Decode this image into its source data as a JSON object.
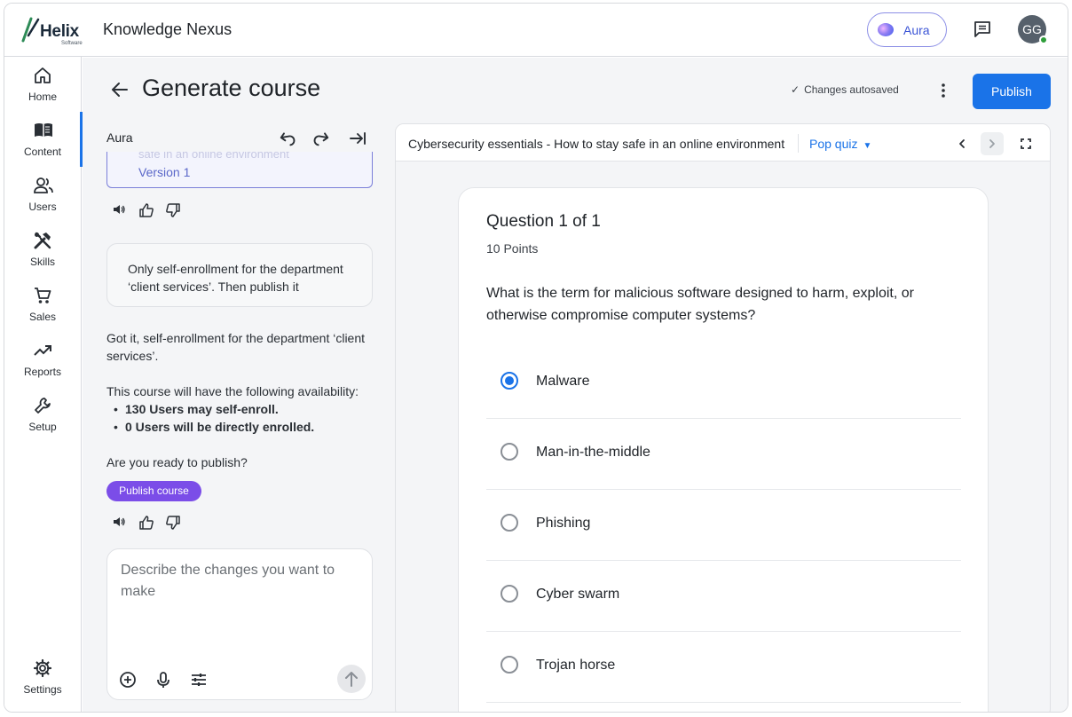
{
  "header": {
    "logo_text": "Helix",
    "logo_sub": "Software",
    "app_title": "Knowledge Nexus",
    "aura_label": "Aura",
    "avatar_initials": "GG"
  },
  "nav": {
    "items": [
      {
        "label": "Home",
        "icon": "home-icon"
      },
      {
        "label": "Content",
        "icon": "book-icon",
        "active": true
      },
      {
        "label": "Users",
        "icon": "users-icon"
      },
      {
        "label": "Skills",
        "icon": "tools-icon"
      },
      {
        "label": "Sales",
        "icon": "cart-icon"
      },
      {
        "label": "Reports",
        "icon": "trending-icon"
      },
      {
        "label": "Setup",
        "icon": "wrench-icon"
      }
    ],
    "settings_label": "Settings"
  },
  "page": {
    "title": "Generate course",
    "autosave": "Changes autosaved",
    "publish_label": "Publish"
  },
  "chat": {
    "title": "Aura",
    "version_faded": "safe in an online environment",
    "version_label": "Version 1",
    "user_message": "Only self-enrollment for the department ‘client services’. Then publish it",
    "reply_1": "Got it, self-enrollment for the department ‘client services’.",
    "reply_2": "This course will have the following availability:",
    "bullets": [
      "130 Users may self-enroll.",
      "0 Users will be directly enrolled."
    ],
    "reply_3": "Are you ready to publish?",
    "publish_chip": "Publish course",
    "composer_placeholder": "Describe the changes you want to make"
  },
  "preview": {
    "course_title": "Cybersecurity essentials - How to stay safe in an online environment",
    "content_type": "Pop quiz",
    "question": {
      "number_label": "Question 1 of 1",
      "points": "10 Points",
      "text": "What is the term for malicious software designed to harm, exploit, or otherwise compromise computer systems?",
      "options": [
        "Malware",
        "Man-in-the-middle",
        "Phishing",
        "Cyber swarm",
        "Trojan horse"
      ],
      "selected_index": 0
    }
  },
  "colors": {
    "accent": "#1a73e8",
    "chip": "#7b4de8",
    "aura_border": "#8c8fe6"
  }
}
